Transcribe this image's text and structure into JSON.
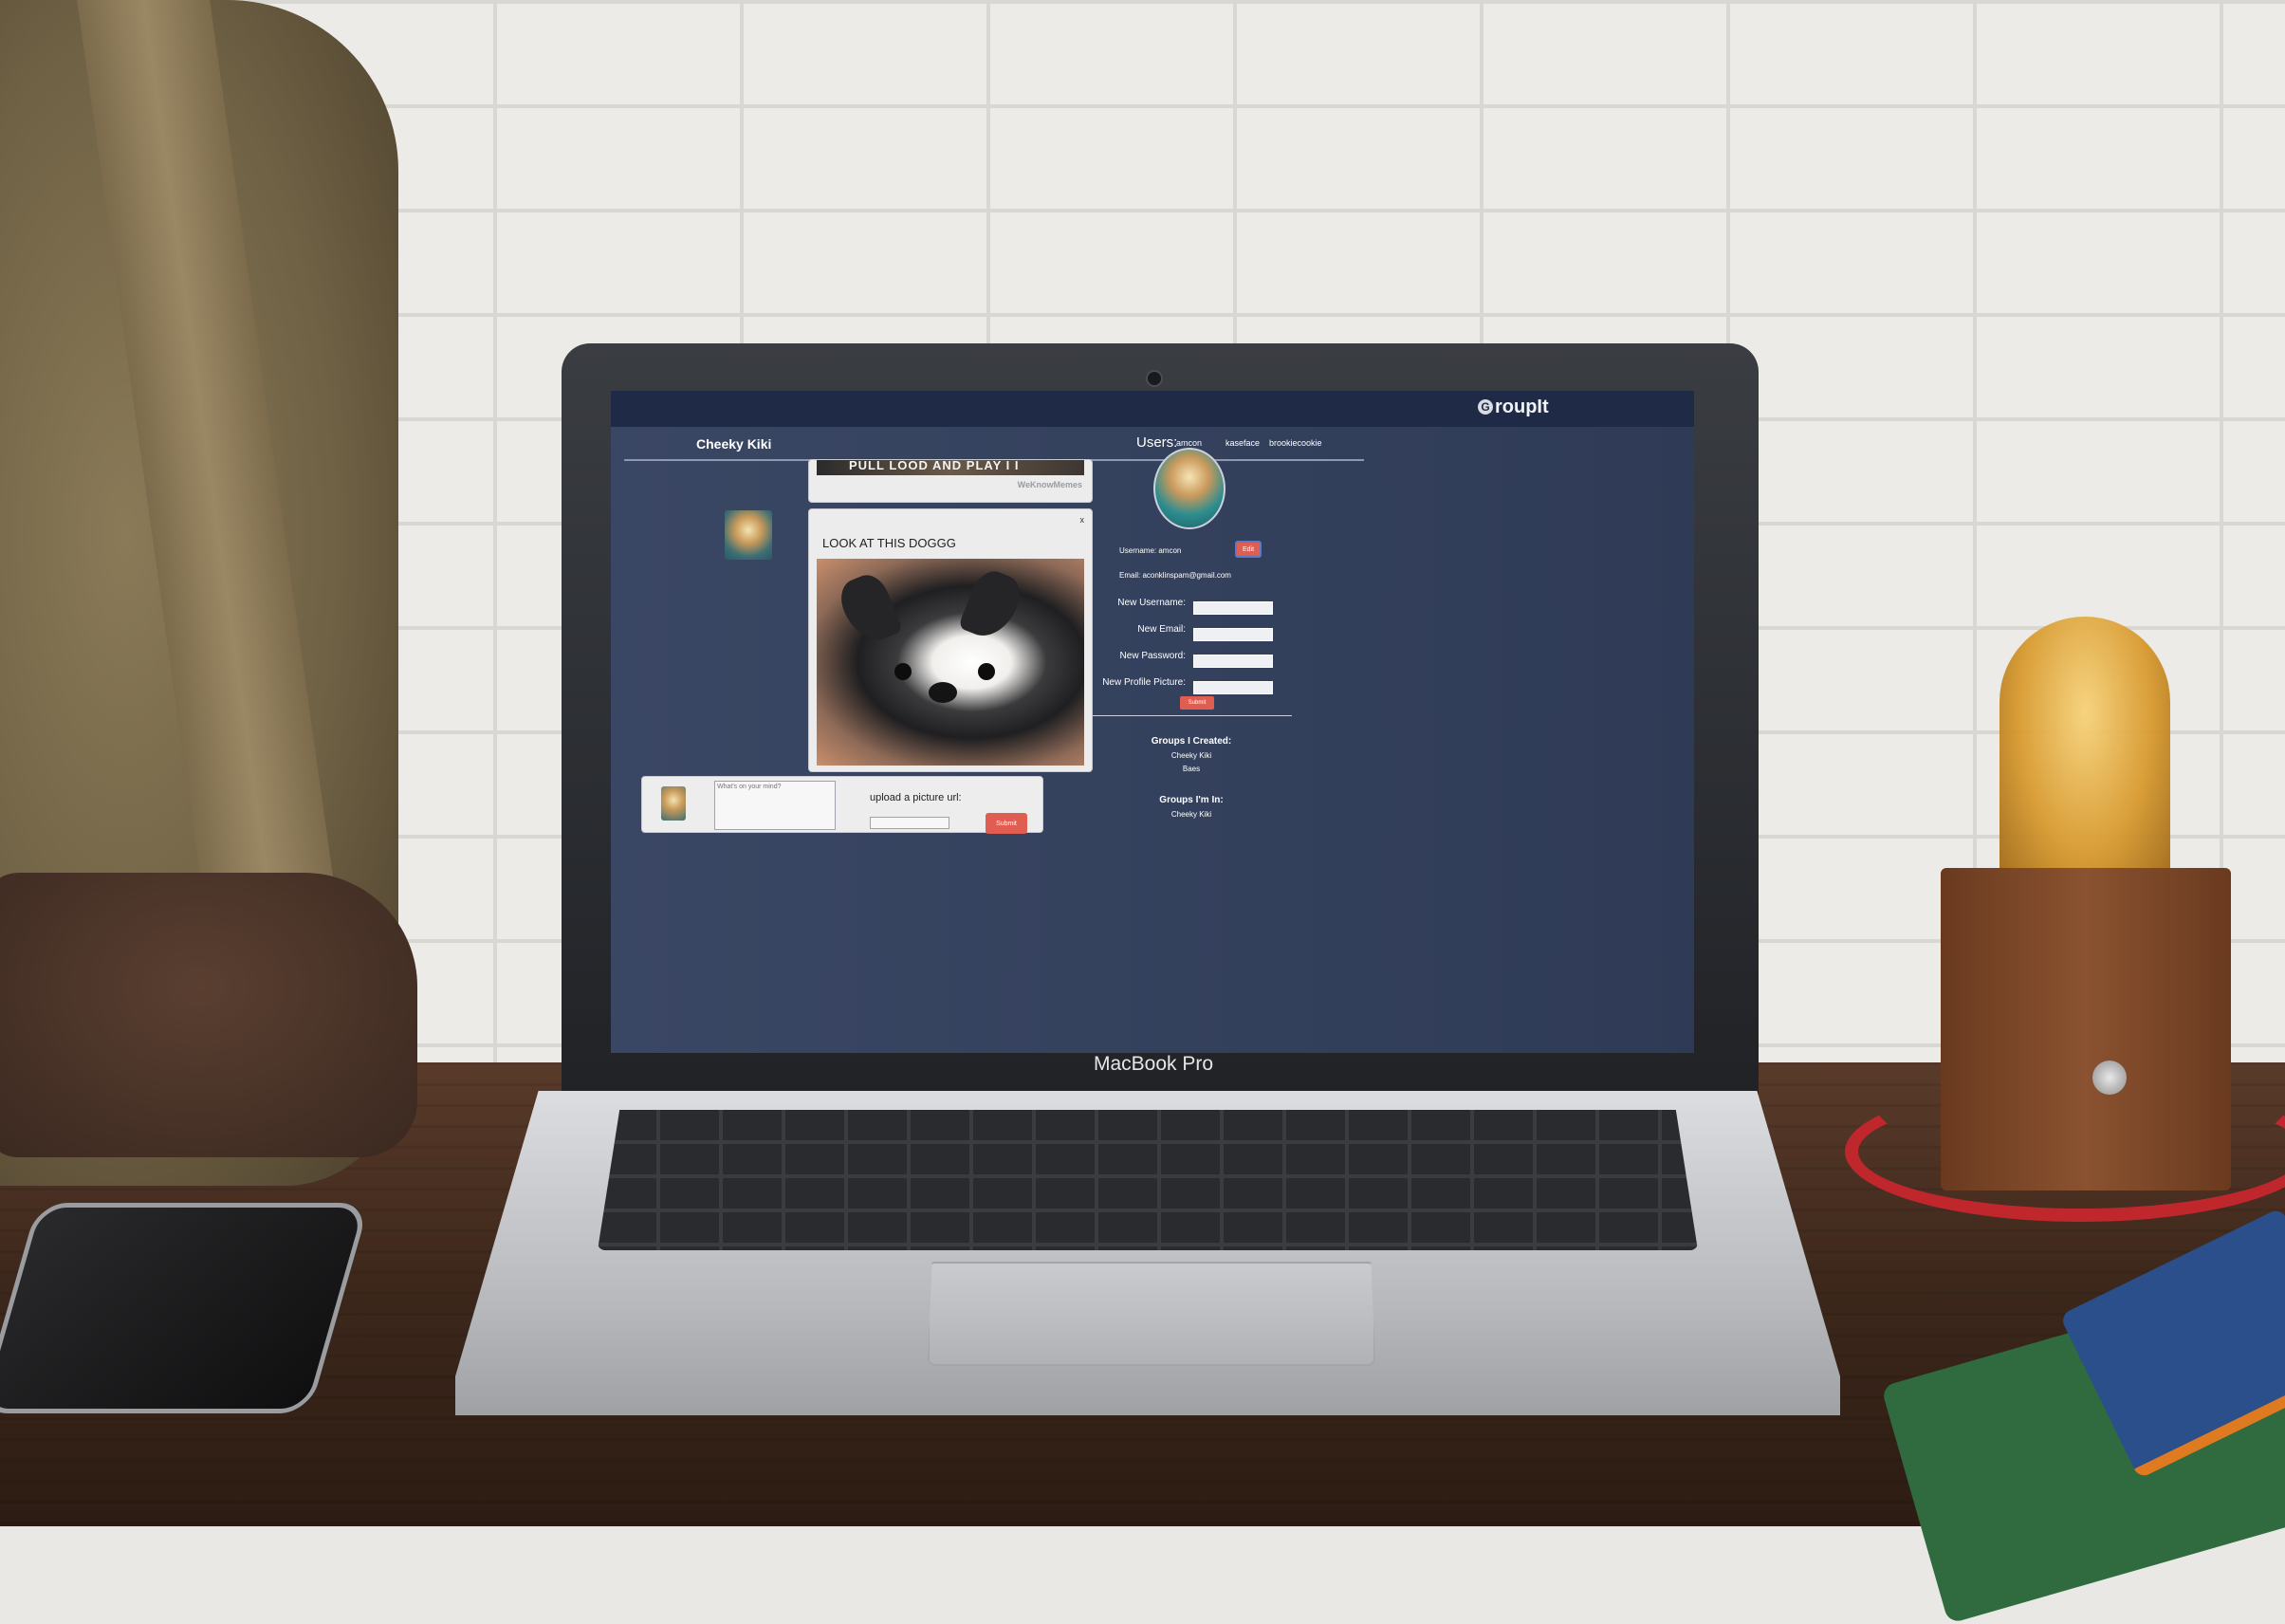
{
  "device": {
    "label": "MacBook Pro"
  },
  "app": {
    "brand_mark": "G",
    "brand_text": "roupIt"
  },
  "group_bar": {
    "group_name": "Cheeky Kiki",
    "users_label": "Users:",
    "users": [
      "amcon",
      "kaseface",
      "brookiecookie"
    ]
  },
  "feed": {
    "meme_text": "PULL LOOD AND PLAY I I",
    "meme_credit": "WeKnowMemes",
    "post": {
      "close": "x",
      "title": "LOOK AT THIS DOGGG"
    }
  },
  "composer": {
    "placeholder": "What's on your mind?",
    "upload_label": "upload a picture url:",
    "submit_label": "Submit"
  },
  "profile": {
    "username_line": "Username: amcon",
    "email_line": "Email: aconklinspam@gmail.com",
    "edit_label": "Edit",
    "form": {
      "new_username": "New Username:",
      "new_email": "New Email:",
      "new_password": "New Password:",
      "new_picture": "New Profile Picture:"
    },
    "submit_label": "Submit",
    "groups_created_title": "Groups I Created:",
    "groups_created": [
      "Cheeky Kiki",
      "Baes"
    ],
    "groups_in_title": "Groups I'm In:",
    "groups_in": [
      "Cheeky Kiki"
    ]
  },
  "colors": {
    "topbar": "#1e2a46",
    "background": "#3a4764",
    "accent_button": "#e05d52",
    "card": "#ececed"
  },
  "icons": [
    "webcam-icon",
    "app-logo-icon",
    "close-icon"
  ]
}
